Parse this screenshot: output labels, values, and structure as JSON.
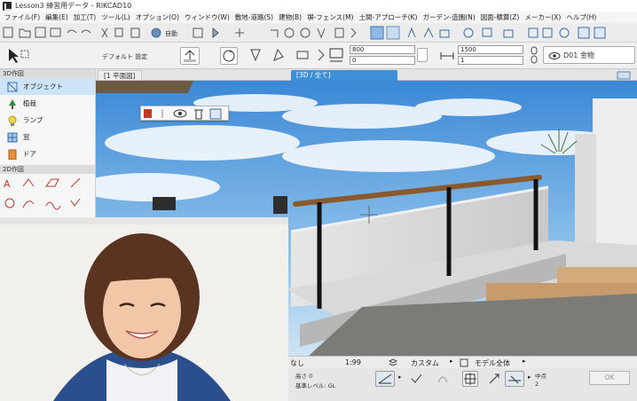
{
  "window": {
    "title": "Lesson3 練習用データ - RIKCAD10"
  },
  "menu": [
    "ファイル(F)",
    "編集(E)",
    "加工(T)",
    "ツール(L)",
    "オプション(O)",
    "ウィンドウ(W)",
    "敷地-道路(S)",
    "建物(B)",
    "塀-フェンス(M)",
    "土間-アプローチ(K)",
    "ガーデン-造園(N)",
    "図面-積算(Z)",
    "メーカー(X)",
    "ヘルプ(H)"
  ],
  "toolbar": {
    "mode_label": "自動"
  },
  "infobar": {
    "default_setting": "デフォルト 設定",
    "field_top_1": "800",
    "field_bottom_1": "0",
    "field_top_2": "1500",
    "field_bottom_2": "1",
    "layer_label": "D01 金物"
  },
  "palette": {
    "section_3d": "3D作図",
    "section_2d": "2D作図",
    "items": [
      "オブジェクト",
      "植栽",
      "ランプ",
      "窓",
      "ドア"
    ]
  },
  "tabs": {
    "plan": "[1 平面図]",
    "view3d": "[3D / 全て]"
  },
  "status": {
    "text_left": "なし",
    "value": "1:99",
    "custom_label": "カスタム",
    "model_label": "モデル全体",
    "height_label": "基準レベル: GL",
    "height_small": "高さ 0",
    "snap_label": "中点",
    "snap_count": "2",
    "ok_label": "OK"
  }
}
